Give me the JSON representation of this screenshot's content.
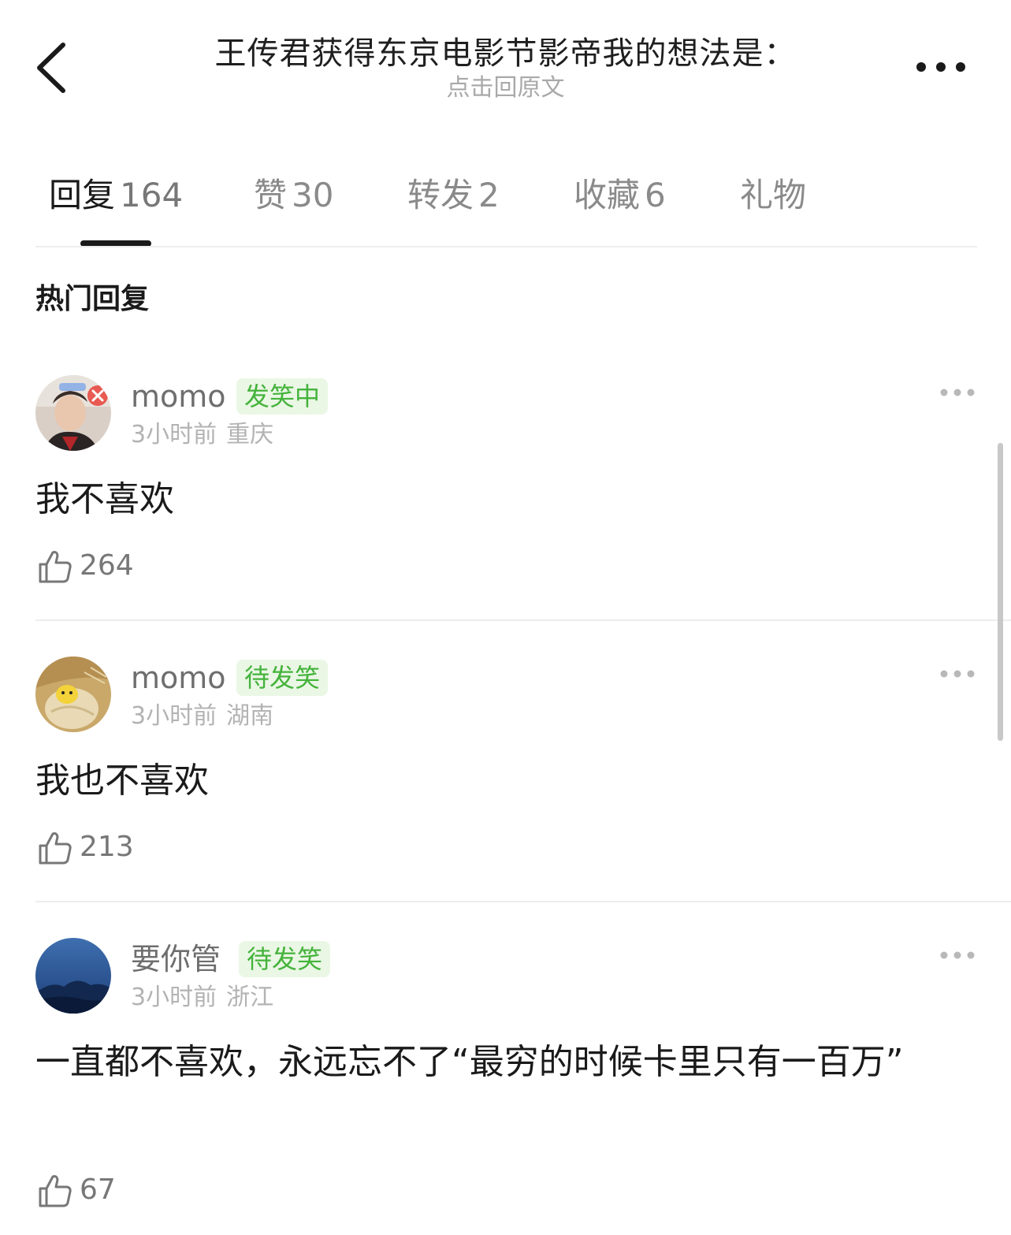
{
  "header": {
    "title": "王传君获得东京电影节影帝我的想法是：",
    "subtitle": "点击回原文"
  },
  "tabs": [
    {
      "label": "回复",
      "count": "164",
      "active": true
    },
    {
      "label": "赞",
      "count": "30",
      "active": false
    },
    {
      "label": "转发",
      "count": "2",
      "active": false
    },
    {
      "label": "收藏",
      "count": "6",
      "active": false
    },
    {
      "label": "礼物",
      "count": "",
      "active": false
    }
  ],
  "section_title": "热门回复",
  "comments": [
    {
      "name": "momo",
      "badge": "发笑中",
      "time": "3小时前",
      "location": "重庆",
      "text": "我不喜欢",
      "likes": "264"
    },
    {
      "name": "momo",
      "badge": "待发笑",
      "time": "3小时前",
      "location": "湖南",
      "text": "我也不喜欢",
      "likes": "213"
    },
    {
      "name": "要你管",
      "badge": "待发笑",
      "time": "3小时前",
      "location": "浙江",
      "text": "一直都不喜欢，永远忘不了“最穷的时候卡里只有一百万”",
      "likes": "67"
    }
  ],
  "colors": {
    "badge_text": "#45b33c",
    "badge_bg": "#eaf7e5",
    "muted": "#b3b3b3"
  },
  "icons": {
    "back": "chevron-left-icon",
    "more": "more-horizontal-icon",
    "like": "thumbs-up-icon"
  }
}
